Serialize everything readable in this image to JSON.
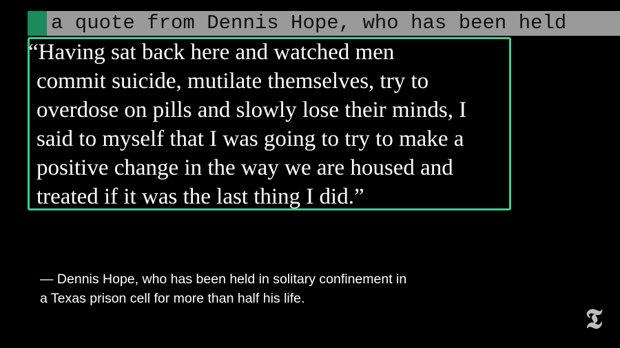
{
  "caption": {
    "text": "a quote from Dennis Hope, who has been held"
  },
  "quote": {
    "lines": [
      "“Having sat back here and watched men",
      "commit suicide, mutilate themselves, try to",
      "overdose on pills and slowly lose their minds, I",
      "said to myself that I was going to try to make a",
      "positive change in the way we are housed and",
      "treated if it was the last thing I did.”"
    ]
  },
  "attribution": {
    "lines": [
      "— Dennis Hope, who has been held in solitary confinement in",
      "a Texas prison cell for more than half his life."
    ]
  },
  "logo": {
    "glyph": "𝕿",
    "icon": "nyt-logo-icon"
  },
  "colors": {
    "background": "#000000",
    "highlight_border": "#3ccf94",
    "caption_marker": "#1c8a5a",
    "caption_background": "#9a9a9a"
  }
}
